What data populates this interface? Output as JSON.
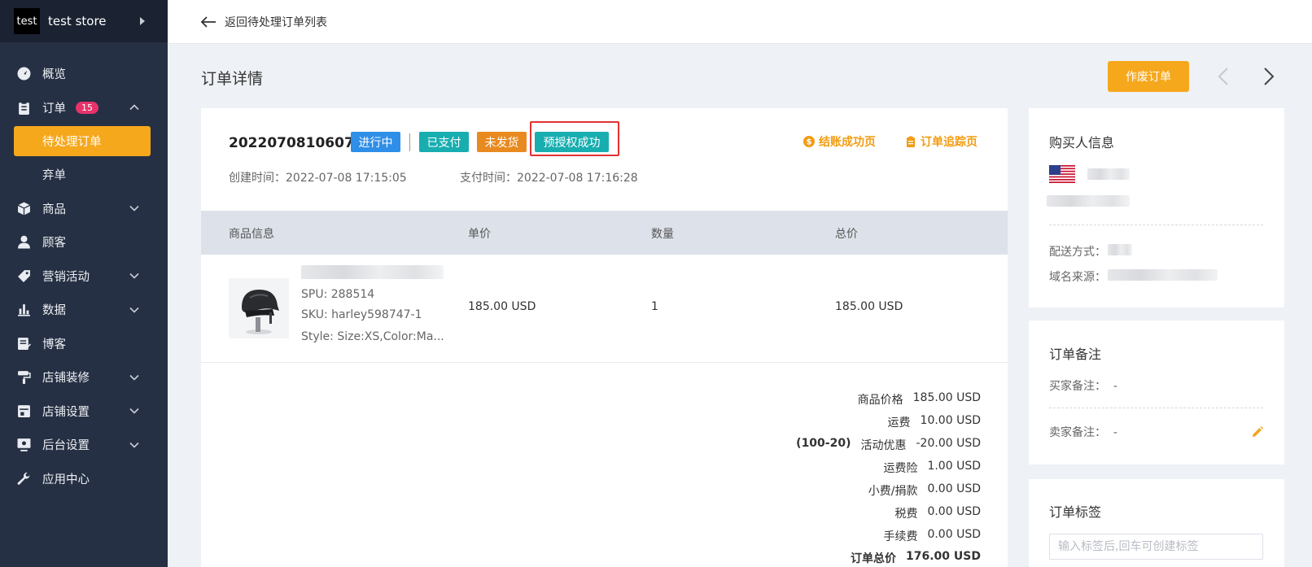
{
  "sidebar": {
    "store_logo": "test",
    "store_name": "test store",
    "items": [
      {
        "label": "概览",
        "icon": "dashboard-icon"
      },
      {
        "label": "订单",
        "icon": "clipboard-icon",
        "badge": "15"
      },
      {
        "label": "待处理订单",
        "active": true
      },
      {
        "label": "弃单"
      },
      {
        "label": "商品",
        "icon": "box-icon"
      },
      {
        "label": "顾客",
        "icon": "user-icon"
      },
      {
        "label": "营销活动",
        "icon": "tag-icon"
      },
      {
        "label": "数据",
        "icon": "bar-chart-icon"
      },
      {
        "label": "博客",
        "icon": "edit-doc-icon"
      },
      {
        "label": "店铺装修",
        "icon": "paint-roller-icon"
      },
      {
        "label": "店铺设置",
        "icon": "store-icon"
      },
      {
        "label": "后台设置",
        "icon": "monitor-gear-icon"
      },
      {
        "label": "应用中心",
        "icon": "wrench-icon"
      }
    ]
  },
  "topbar": {
    "back_label": "返回待处理订单列表"
  },
  "page": {
    "title": "订单详情",
    "void_button": "作废订单"
  },
  "order": {
    "number": "2022070810607",
    "tags": {
      "progress": "进行中",
      "paid": "已支付",
      "unshipped": "未发货",
      "preauth": "预授权成功"
    },
    "links": {
      "checkout": "结账成功页",
      "tracking": "订单追踪页"
    },
    "created": "创建时间：2022-07-08 17:15:05",
    "paid_time": "支付时间：2022-07-08 17:16:28",
    "table": {
      "headers": [
        "商品信息",
        "单价",
        "数量",
        "总价"
      ],
      "product": {
        "spu": "SPU: 288514",
        "sku": "SKU: harley598747-1",
        "style": "Style: Size:XS,Color:Ma...",
        "unit_price": "185.00 USD",
        "qty": "1",
        "total": "185.00 USD"
      }
    },
    "summary": [
      {
        "label": "商品价格",
        "value": "185.00 USD"
      },
      {
        "label": "运费",
        "value": "10.00 USD"
      },
      {
        "prefix": "(100-20)",
        "label": "活动优惠",
        "value": "-20.00 USD"
      },
      {
        "label": "运费险",
        "value": "1.00 USD"
      },
      {
        "label": "小费/捐款",
        "value": "0.00 USD"
      },
      {
        "label": "税费",
        "value": "0.00 USD"
      },
      {
        "label": "手续费",
        "value": "0.00 USD"
      },
      {
        "label": "订单总价",
        "value": "176.00 USD"
      }
    ]
  },
  "buyer": {
    "title": "购买人信息",
    "shipping_label": "配送方式：",
    "domain_label": "域名来源："
  },
  "notes": {
    "title": "订单备注",
    "buyer_label": "买家备注：",
    "buyer_value": "-",
    "seller_label": "卖家备注：",
    "seller_value": "-"
  },
  "tags_card": {
    "title": "订单标签",
    "placeholder": "输入标签后,回车可创建标签"
  },
  "colors": {
    "sidebar_bg": "#263044",
    "accent": "#f6a81d",
    "blue_tag": "#2f8ee8",
    "teal_tag": "#18aeb0",
    "orange_tag": "#e88a1f",
    "highlight": "#e23232"
  }
}
